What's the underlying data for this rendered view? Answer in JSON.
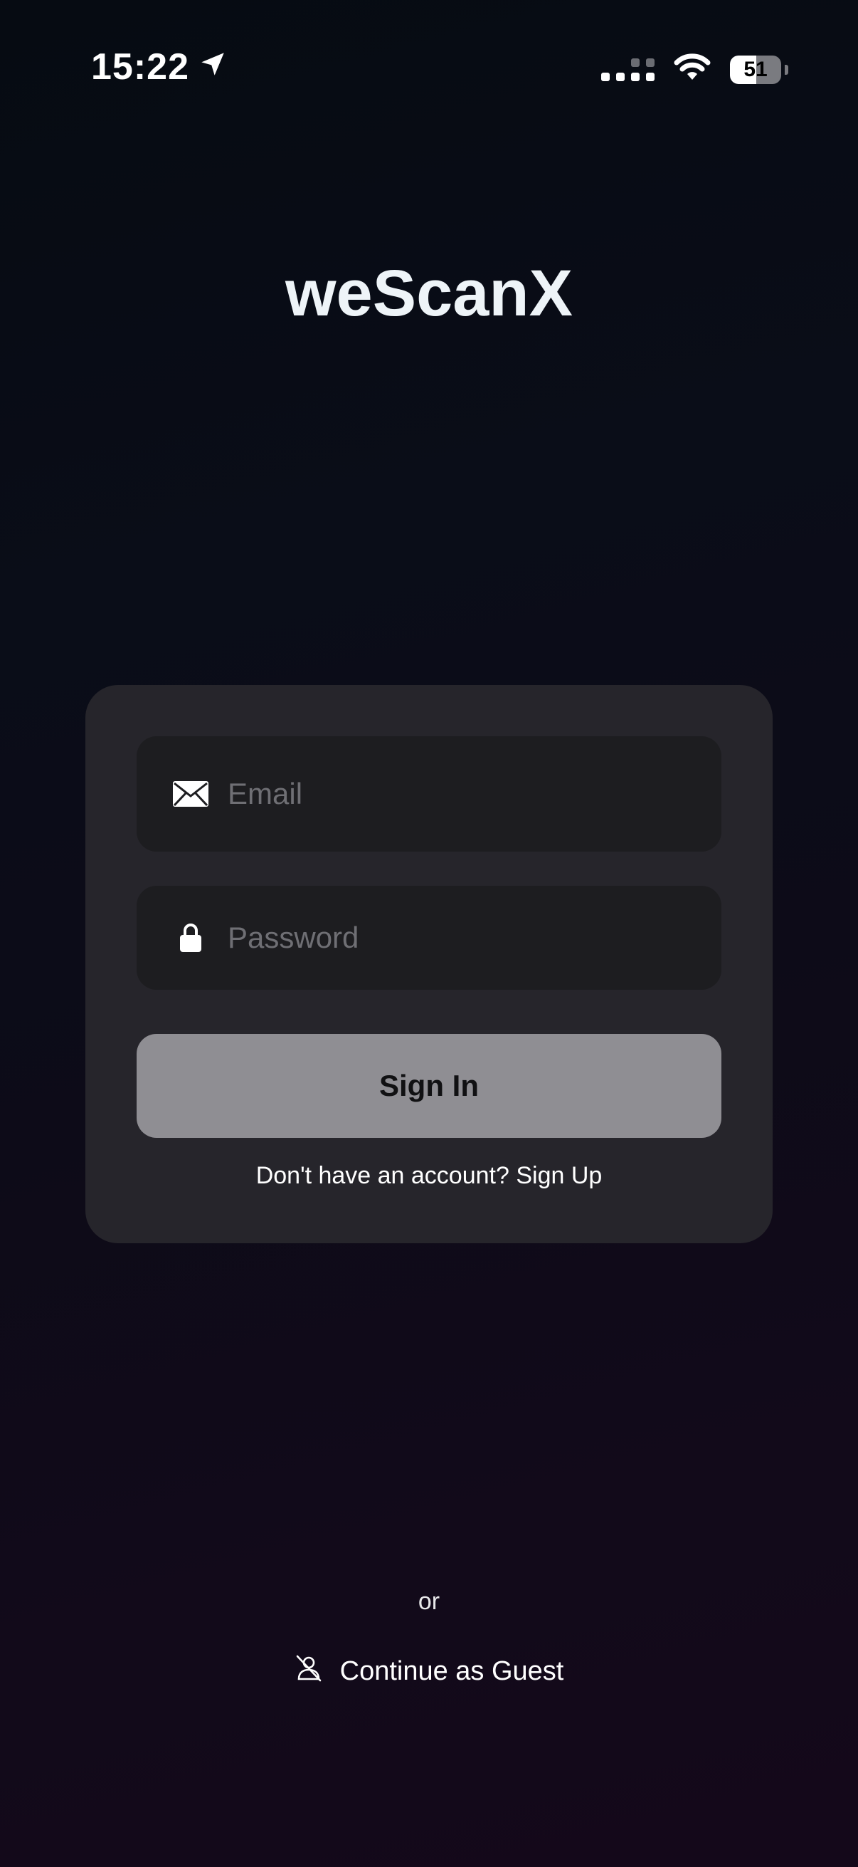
{
  "status_bar": {
    "time": "15:22",
    "battery": "51",
    "battery_level": 0.51
  },
  "app": {
    "title": "weScanX"
  },
  "login": {
    "email_placeholder": "Email",
    "password_placeholder": "Password",
    "sign_in_label": "Sign In",
    "signup_prompt": "Don't have an account? Sign Up"
  },
  "footer": {
    "or_label": "or",
    "guest_label": "Continue as Guest"
  },
  "icons": {
    "email": "envelope-icon",
    "password": "lock-icon",
    "guest": "person-slash-icon",
    "location": "location-arrow-icon"
  }
}
